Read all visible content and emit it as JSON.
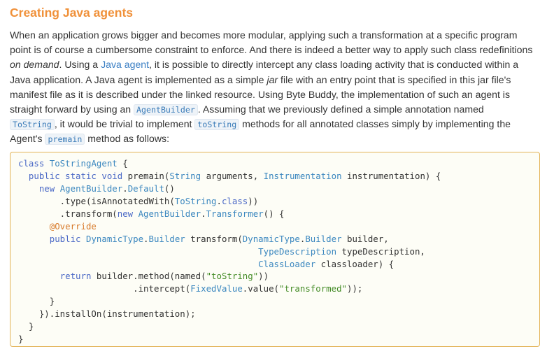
{
  "heading": "Creating Java agents",
  "paragraph": {
    "l1": "When an application grows bigger and becomes more modular, applying such a transformation at a specific program",
    "l2": "point is of course a cumbersome constraint to enforce. And there is indeed a better way to apply such class redefinitions",
    "l3_em": "on demand",
    "l3_a": ". Using a ",
    "l3_link": "Java agent",
    "l3_b": ", it is possible to directly intercept any class loading activity that is conducted within a",
    "l4_a": "Java application. A Java agent is implemented as a simple ",
    "l4_em": "jar",
    "l4_b": " file with an entry point that is specified in this jar file's",
    "l5": "manifest file as it is described under the linked resource. Using Byte Buddy, the implementation of such an agent is",
    "l6_a": "straight forward by using an ",
    "l6_code": "AgentBuilder",
    "l6_b": ". Assuming that we previously defined a simple annotation named",
    "l7_code1": "ToString",
    "l7_a": ", it would be trivial to implement ",
    "l7_code2": "toString",
    "l7_b": " methods for all annotated classes simply by implementing the",
    "l8_a": "Agent's ",
    "l8_code": "premain",
    "l8_b": " method as follows:"
  },
  "code": {
    "c1": "class ",
    "c2": "ToStringAgent",
    "c3": " {",
    "c4": "  public static void",
    "c5": " premain(",
    "c6": "String",
    "c7": " arguments, ",
    "c8": "Instrumentation",
    "c9": " instrumentation) {",
    "c10": "    new ",
    "c11": "AgentBuilder",
    "c12": ".",
    "c13": "Default",
    "c14": "()",
    "c15": "        .type(isAnnotatedWith(",
    "c16": "ToString",
    "c17": ".",
    "c18": "class",
    "c19": "))",
    "c20": "        .transform(",
    "c21": "new ",
    "c22": "AgentBuilder",
    "c23": ".",
    "c24": "Transformer",
    "c25": "() {",
    "c26": "      @Override",
    "c27": "      public ",
    "c28": "DynamicType",
    "c29": ".",
    "c30": "Builder",
    "c31": " transform(",
    "c32": "DynamicType",
    "c33": ".",
    "c34": "Builder",
    "c35": " builder,",
    "c36": "                                              ",
    "c37": "TypeDescription",
    "c38": " typeDescription,",
    "c39": "                                              ",
    "c40": "ClassLoader",
    "c41": " classloader) {",
    "c42": "        return ",
    "c43": "builder.method(named(",
    "c44": "\"toString\"",
    "c45": "))",
    "c46": "                      .intercept(",
    "c47": "FixedValue",
    "c48": ".value(",
    "c49": "\"transformed\"",
    "c50": "));",
    "c51": "      }",
    "c52": "    }).installOn(instrumentation);",
    "c53": "  }",
    "c54": "}"
  }
}
